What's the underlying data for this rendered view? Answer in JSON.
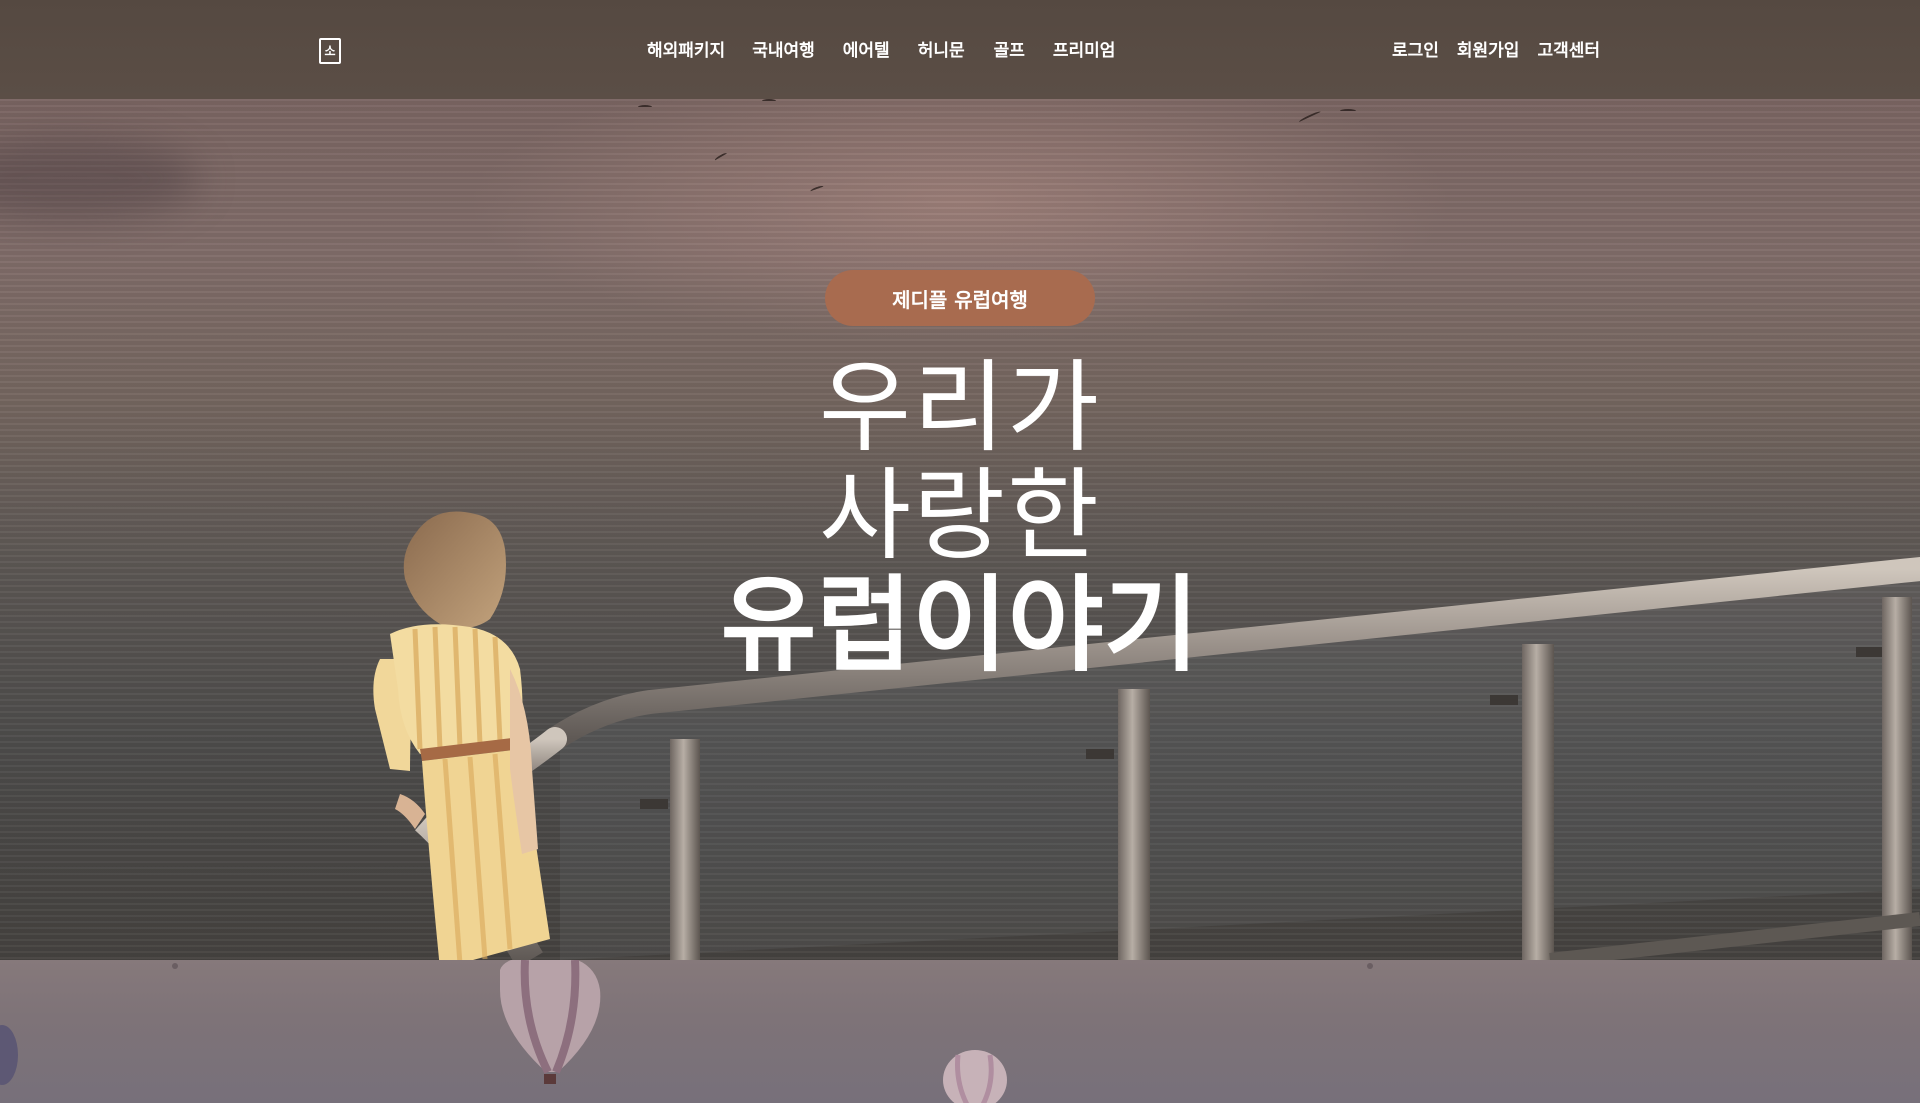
{
  "header": {
    "logo_glyph": "소",
    "nav": [
      "해외패키지",
      "국내여행",
      "에어텔",
      "허니문",
      "골프",
      "프리미엄"
    ],
    "util": [
      "로그인",
      "회원가입",
      "고객센터"
    ]
  },
  "hero": {
    "badge": "제디플 유럽여행",
    "line1": "우리가",
    "line2": "사랑한",
    "line3": "유럽이야기"
  },
  "colors": {
    "header_bg": "#554941",
    "badge_bg": "#a86b4f",
    "text": "#ffffff"
  }
}
